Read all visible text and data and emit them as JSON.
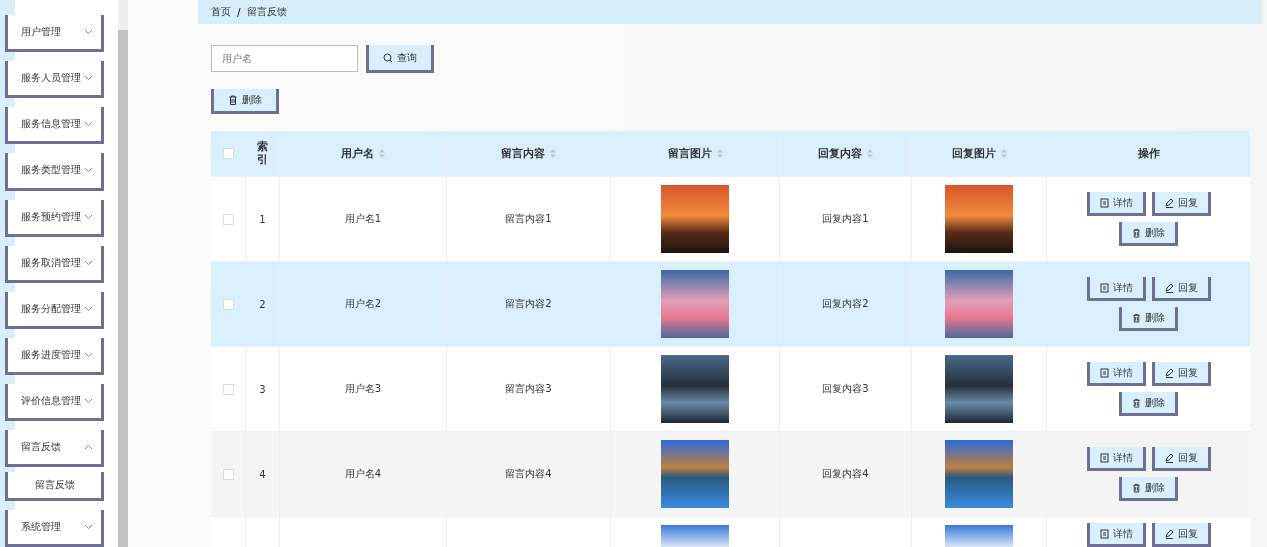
{
  "sidebar": {
    "items": [
      {
        "label": "用户管理",
        "expanded": false
      },
      {
        "label": "服务人员管理",
        "expanded": false
      },
      {
        "label": "服务信息管理",
        "expanded": false
      },
      {
        "label": "服务类型管理",
        "expanded": false
      },
      {
        "label": "服务预约管理",
        "expanded": false
      },
      {
        "label": "服务取消管理",
        "expanded": false
      },
      {
        "label": "服务分配管理",
        "expanded": false
      },
      {
        "label": "服务进度管理",
        "expanded": false
      },
      {
        "label": "评价信息管理",
        "expanded": false
      },
      {
        "label": "留言反馈",
        "expanded": true,
        "children": [
          {
            "label": "留言反馈"
          }
        ]
      },
      {
        "label": "系统管理",
        "expanded": false
      }
    ]
  },
  "breadcrumb": [
    "首页",
    "/",
    "留言反馈"
  ],
  "search": {
    "placeholder": "用户名",
    "button": "查询"
  },
  "delete_button": "删除",
  "table": {
    "select_all_checked": false,
    "columns": [
      {
        "label": "索引",
        "sortable": false
      },
      {
        "label": "用户名",
        "sortable": true
      },
      {
        "label": "留言内容",
        "sortable": true
      },
      {
        "label": "留言图片",
        "sortable": true
      },
      {
        "label": "回复内容",
        "sortable": true
      },
      {
        "label": "回复图片",
        "sortable": true
      },
      {
        "label": "操作",
        "sortable": false
      }
    ],
    "rows": [
      {
        "index": "1",
        "username": "用户名1",
        "message": "留言内容1",
        "message_image": {
          "kind": "sunset"
        },
        "reply": "回复内容1",
        "reply_image": {
          "kind": "sunset"
        },
        "actions": [
          "详情",
          "回复",
          "删除"
        ],
        "highlighted": false,
        "checked": false
      },
      {
        "index": "2",
        "username": "用户名2",
        "message": "留言内容2",
        "message_image": {
          "kind": "sky"
        },
        "reply": "回复内容2",
        "reply_image": {
          "kind": "sky"
        },
        "actions": [
          "详情",
          "回复",
          "删除"
        ],
        "highlighted": true,
        "checked": false
      },
      {
        "index": "3",
        "username": "用户名3",
        "message": "留言内容3",
        "message_image": {
          "kind": "river"
        },
        "reply": "回复内容3",
        "reply_image": {
          "kind": "river"
        },
        "actions": [
          "详情",
          "回复",
          "删除"
        ],
        "highlighted": false,
        "checked": false
      },
      {
        "index": "4",
        "username": "用户名4",
        "message": "留言内容4",
        "message_image": {
          "kind": "lake"
        },
        "reply": "回复内容4",
        "reply_image": {
          "kind": "lake"
        },
        "actions": [
          "详情",
          "回复",
          "删除"
        ],
        "highlighted": false,
        "checked": false
      },
      {
        "message_image": {
          "kind": "sunflower"
        },
        "reply_image": {
          "kind": "sunflower"
        },
        "actions": [
          "详情",
          "回复"
        ],
        "highlighted": false
      }
    ]
  }
}
